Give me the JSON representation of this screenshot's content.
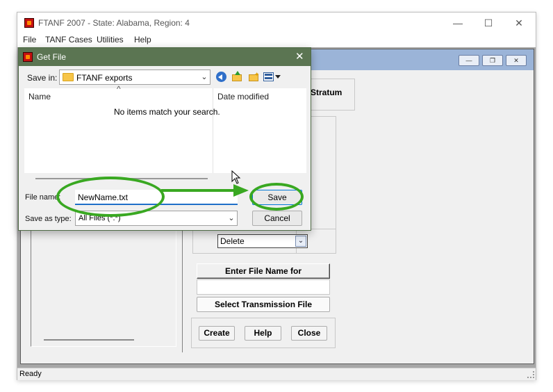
{
  "main_window": {
    "title": "FTANF 2007 - State: Alabama, Region: 4",
    "controls": {
      "minimize": "—",
      "maximize": "☐",
      "close": "✕"
    }
  },
  "menu": [
    "File",
    "TANF Cases",
    "Utilities",
    "Help"
  ],
  "child_window": {
    "controls": {
      "minimize": "—",
      "restore": "❐",
      "close": "✕"
    }
  },
  "form": {
    "stratum_label": "Stratum",
    "action_select": {
      "value": "Delete"
    },
    "transmission_label": "Enter File Name for Transmission",
    "transmission_value": "",
    "select_transmission_button": "Select Transmission File",
    "create_button": "Create",
    "help_button": "Help",
    "close_button": "Close"
  },
  "status_bar": {
    "text": "Ready"
  },
  "dialog": {
    "title": "Get File",
    "save_in_label": "Save in:",
    "save_in_value": "FTANF exports",
    "columns": {
      "name": "Name",
      "date_modified": "Date modified"
    },
    "sort_indicator": "^",
    "empty_message": "No items match your search.",
    "file_name_label": "File name:",
    "file_name_value": "NewName.txt",
    "save_as_type_label": "Save as type:",
    "save_as_type_value": "All Files (*.*)",
    "save_button": "Save",
    "cancel_button": "Cancel",
    "close_glyph": "✕",
    "toolbar_icons": [
      "back-icon",
      "up-folder-icon",
      "new-folder-icon",
      "view-menu-icon"
    ]
  },
  "annotation": {
    "color": "#39a821"
  }
}
